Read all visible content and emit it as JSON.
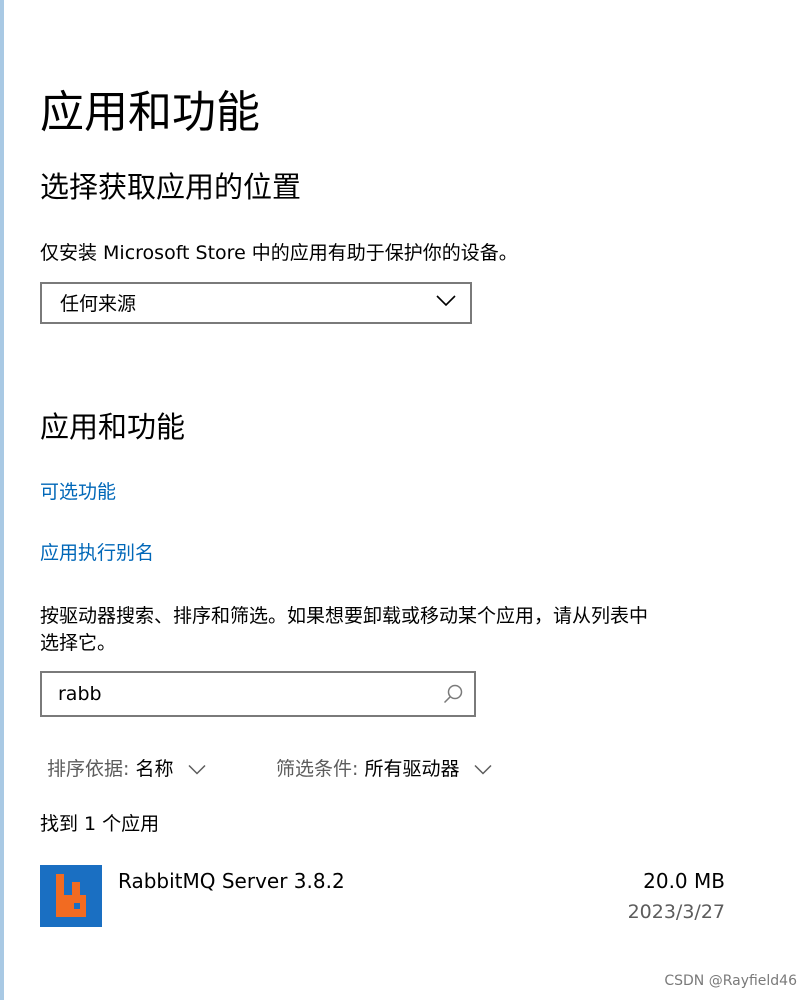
{
  "page": {
    "title": "应用和功能"
  },
  "install_source": {
    "heading": "选择获取应用的位置",
    "description": "仅安装 Microsoft Store 中的应用有助于保护你的设备。",
    "dropdown_value": "任何来源"
  },
  "apps_features": {
    "heading": "应用和功能",
    "links": {
      "optional_features": "可选功能",
      "app_execution_aliases": "应用执行别名"
    },
    "help_text_line1": "按驱动器搜索、排序和筛选。如果想要卸载或移动某个应用，请从列表中",
    "help_text_line2": "选择它。",
    "search": {
      "value": "rabb",
      "icon": "search-icon"
    },
    "sort": {
      "label": "排序依据:",
      "value": "名称"
    },
    "filter": {
      "label": "筛选条件:",
      "value": "所有驱动器"
    },
    "result_count": "找到 1 个应用",
    "apps": [
      {
        "name": "RabbitMQ Server 3.8.2",
        "size": "20.0 MB",
        "date": "2023/3/27",
        "icon": "rabbitmq-icon"
      }
    ]
  },
  "watermark": "CSDN @Rayfield46",
  "colors": {
    "link": "#0067b8",
    "app_icon_bg": "#1a6fc2",
    "rabbitmq_orange": "#f26b21",
    "secondary_text": "#5c5c5c",
    "border": "#7a7a7a"
  }
}
